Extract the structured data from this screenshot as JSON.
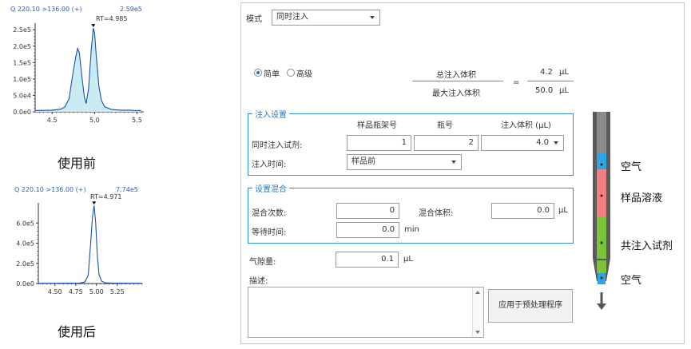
{
  "charts": {
    "before": {
      "title": "Q 220.10 >136.00 (+)",
      "max": "2.59e5",
      "rt": "RT=4.985",
      "caption": "使用前"
    },
    "after": {
      "title": "Q 220.10 >136.00 (+)",
      "max": "7.74e5",
      "rt": "RT=4.971",
      "caption": "使用后"
    }
  },
  "chart_data": [
    {
      "type": "line",
      "title": "Q 220.10 >136.00 (+)",
      "annotation": "RT=4.985",
      "max_label": "2.59e5",
      "x": [
        4.3,
        4.5,
        4.6,
        4.65,
        4.7,
        4.74,
        4.78,
        4.8,
        4.82,
        4.85,
        4.88,
        4.9,
        4.93,
        4.96,
        4.985,
        5.0,
        5.02,
        5.05,
        5.08,
        5.12,
        5.2,
        5.3,
        5.4,
        5.5,
        5.55
      ],
      "y": [
        4000,
        5000,
        8000,
        15000,
        40000,
        110000,
        170000,
        193000,
        180000,
        110000,
        45000,
        25000,
        70000,
        185000,
        255000,
        240000,
        170000,
        80000,
        35000,
        15000,
        7000,
        5000,
        5000,
        4000,
        4000
      ],
      "xticks": [
        "4.5",
        "5.0",
        "5.5"
      ],
      "xtick_values": [
        4.5,
        5.0,
        5.5
      ],
      "yticks": [
        "0.0e0",
        "5.0e4",
        "1.0e5",
        "1.5e5",
        "2.0e5",
        "2.5e5"
      ],
      "ytick_values": [
        0,
        50000,
        100000,
        150000,
        200000,
        250000
      ],
      "xlim": [
        4.3,
        5.58
      ],
      "ylim": [
        0,
        270000
      ],
      "fill": true
    },
    {
      "type": "line",
      "title": "Q 220.10 >136.00 (+)",
      "annotation": "RT=4.971",
      "max_label": "7.74e5",
      "x": [
        4.3,
        4.5,
        4.7,
        4.8,
        4.86,
        4.9,
        4.93,
        4.95,
        4.971,
        4.99,
        5.01,
        5.03,
        5.06,
        5.1,
        5.2,
        5.3,
        5.4,
        5.55
      ],
      "y": [
        2000,
        2000,
        3000,
        5000,
        15000,
        80000,
        400000,
        650000,
        774000,
        600000,
        280000,
        90000,
        25000,
        8000,
        4000,
        3000,
        2000,
        2000
      ],
      "xticks": [
        "4.50",
        "4.75",
        "5.00",
        "5.25"
      ],
      "xtick_values": [
        4.5,
        4.75,
        5.0,
        5.25
      ],
      "yticks": [
        "0.0e0",
        "2.0e5",
        "4.0e5",
        "6.0e5"
      ],
      "ytick_values": [
        0,
        200000,
        400000,
        600000
      ],
      "xlim": [
        4.3,
        5.55
      ],
      "ylim": [
        0,
        800000
      ],
      "fill": false
    }
  ],
  "form": {
    "mode_label": "模式",
    "mode_value": "同时注入",
    "radio_simple": "简单",
    "radio_advanced": "高级",
    "total_label": "总注入体积",
    "total_value": "4.2",
    "max_label": "最大注入体积",
    "max_value": "50.0",
    "unit_ul": "μL",
    "equals": "=",
    "injection_group": "注入设置",
    "col_rack": "样品瓶架号",
    "col_vial": "瓶号",
    "col_volume": "注入体积 (μL)",
    "coinject_label": "同时注入试剂:",
    "rack_value": "1",
    "vial_value": "2",
    "volume_value": "4.0",
    "time_label": "注入时间:",
    "time_value": "样品前",
    "mix_group": "设置混合",
    "mix_count_label": "混合次数:",
    "mix_count_value": "0",
    "mix_volume_label": "混合体积:",
    "mix_volume_value": "0.0",
    "wait_label": "等待时间:",
    "wait_value": "0.0",
    "unit_min": "min",
    "air_gap_label": "气隙量:",
    "air_gap_value": "0.1",
    "desc_label": "描述:",
    "apply_button": "应用于预处理程序"
  },
  "syringe": {
    "labels": [
      "空气",
      "样品溶液",
      "共注入试剂",
      "空气"
    ],
    "colors": {
      "air": "#2ea4e6",
      "sample": "#f08080",
      "reagent": "#7cc23a",
      "barrel": "#5a5a5a"
    }
  }
}
